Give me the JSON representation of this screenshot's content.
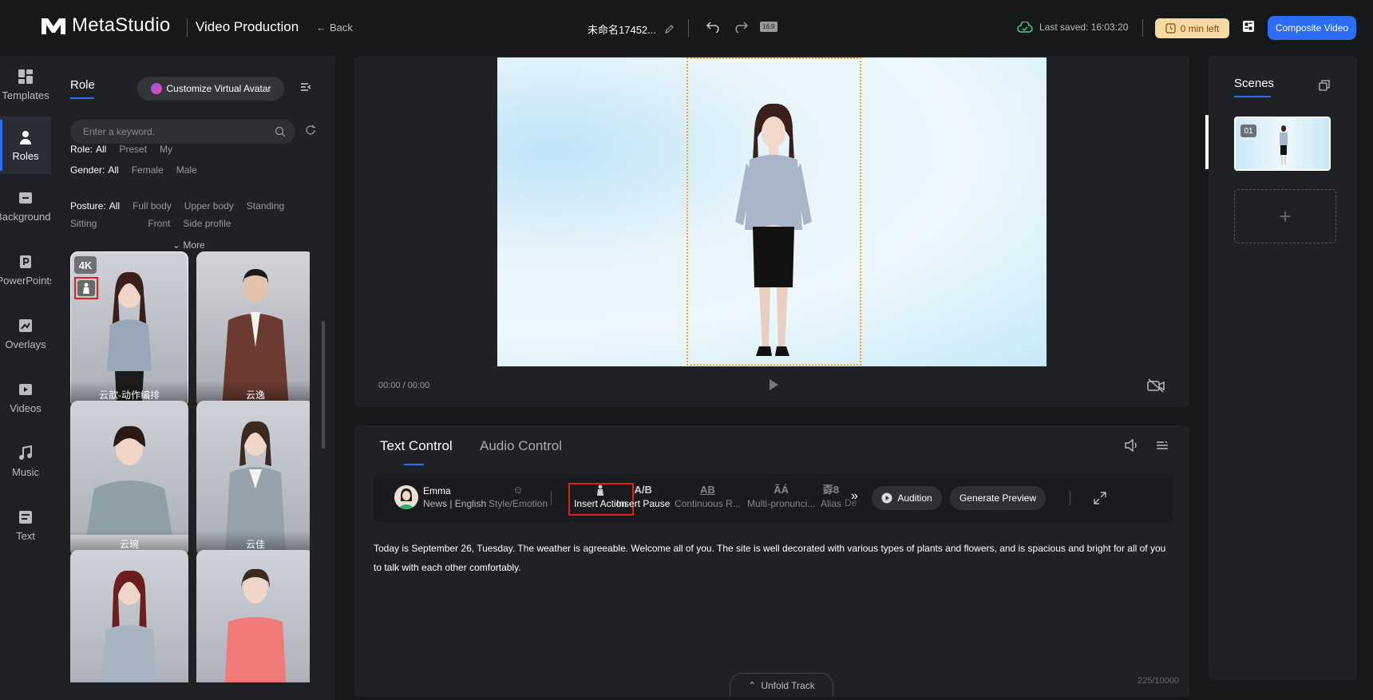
{
  "header": {
    "app_name": "MetaStudio",
    "product": "Video Production",
    "back_label": "Back",
    "project_title": "未命名17452...",
    "ratio": "16:9",
    "last_saved": "Last saved: 16:03:20",
    "time_left": "0 min left",
    "composite_label": "Composite Video"
  },
  "nav": {
    "items": [
      {
        "label": "Templates",
        "icon": "templates-icon"
      },
      {
        "label": "Roles",
        "icon": "roles-icon"
      },
      {
        "label": "Backgrounds",
        "icon": "backgrounds-icon"
      },
      {
        "label": "PowerPoints",
        "icon": "powerpoint-icon"
      },
      {
        "label": "Overlays",
        "icon": "overlays-icon"
      },
      {
        "label": "Videos",
        "icon": "videos-icon"
      },
      {
        "label": "Music",
        "icon": "music-icon"
      },
      {
        "label": "Text",
        "icon": "text-icon"
      }
    ],
    "active": "Roles"
  },
  "role_panel": {
    "tab": "Role",
    "customize": "Customize Virtual Avatar",
    "search_placeholder": "Enter a keyword.",
    "filters": {
      "role": {
        "label": "Role:",
        "options": [
          "All",
          "Preset",
          "My"
        ]
      },
      "gender": {
        "label": "Gender:",
        "options": [
          "All",
          "Female",
          "Male"
        ]
      },
      "posture": {
        "label": "Posture:",
        "options": [
          "All",
          "Full body",
          "Upper body",
          "Standing",
          "Sitting",
          "Front",
          "Side profile"
        ]
      }
    },
    "more": "More",
    "badge_4k": "4K",
    "cards": [
      "云歆-动作编排",
      "云逸",
      "云琬",
      "云佳",
      "",
      ""
    ]
  },
  "preview": {
    "timecode": "00:00 / 00:00"
  },
  "text_panel": {
    "tabs": [
      "Text Control",
      "Audio Control"
    ],
    "speaker_name": "Emma",
    "speaker_sub": "News | English",
    "tools": {
      "style": {
        "glyph": "☺",
        "label": "Style/Emotion"
      },
      "insert_action": {
        "label": "Insert Action"
      },
      "insert_pause": {
        "glyph": "A/B",
        "label": "Insert Pause"
      },
      "continuous": {
        "glyph": "AB",
        "label": "Continuous R..."
      },
      "multi": {
        "glyph": "ÃÁ",
        "label": "Multi-pronunci..."
      },
      "alias": {
        "glyph": "孬8",
        "label": "Alias"
      },
      "de": {
        "label": "De"
      }
    },
    "audition": "Audition",
    "generate_preview": "Generate Preview",
    "script": "Today is September 26, Tuesday. The weather is agreeable. Welcome all of you. The site is well decorated with various types of plants and flowers, and is spacious and bright for all of you to talk with each other comfortably.",
    "count": "225/10000",
    "unfold": "Unfold Track"
  },
  "scenes": {
    "title": "Scenes",
    "items": [
      {
        "num": "01"
      }
    ],
    "add": "+"
  },
  "colors": {
    "accent": "#2c6df6",
    "highlight": "#e02020",
    "warning_bg": "#f6d9a3"
  }
}
